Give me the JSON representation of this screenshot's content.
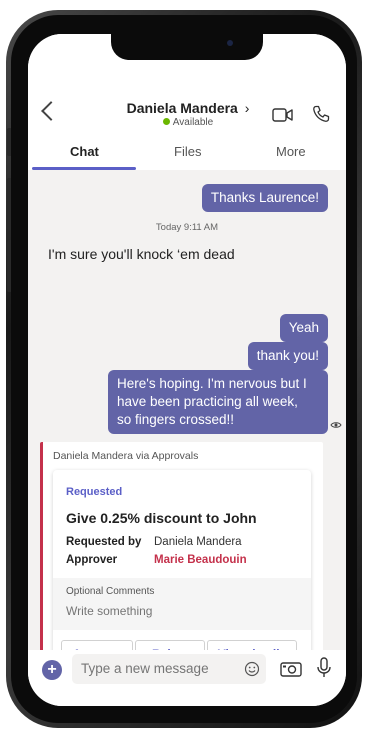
{
  "header": {
    "contact_name": "Daniela Mandera",
    "chevron": "›",
    "status": "Available",
    "back_icon": "chevron-left",
    "video_icon": "video-call",
    "call_icon": "phone"
  },
  "tabs": [
    {
      "label": "Chat",
      "active": true
    },
    {
      "label": "Files",
      "active": false
    },
    {
      "label": "More",
      "active": false
    }
  ],
  "messages": {
    "out_1": "Thanks Laurence!",
    "timestamp": "Today 9:11 AM",
    "in_1": "I'm sure you'll knock ‘em dead",
    "out_2": "Yeah",
    "out_3": "thank you!",
    "out_4_line1": "Here's hoping. I'm nervous but I",
    "out_4_line2": "have been practicing all week,",
    "out_4_line3": "so fingers crossed!!"
  },
  "approval_card": {
    "via": "Daniela Mandera via Approvals",
    "status": "Requested",
    "title": "Give 0.25% discount to John",
    "requested_by_label": "Requested by",
    "requested_by_value": "Daniela Mandera",
    "approver_label": "Approver",
    "approver_value": "Marie Beaudouin",
    "comments_label": "Optional Comments",
    "comments_placeholder": "Write something",
    "buttons": {
      "approve": "Approve",
      "reject": "Reject",
      "view_details": "View details"
    }
  },
  "composer": {
    "placeholder": "Type a new message",
    "plus": "+"
  },
  "colors": {
    "accent": "#6264a7",
    "status_available": "#6bb700",
    "approver": "#c4314b",
    "card_border": "#c4314b"
  }
}
